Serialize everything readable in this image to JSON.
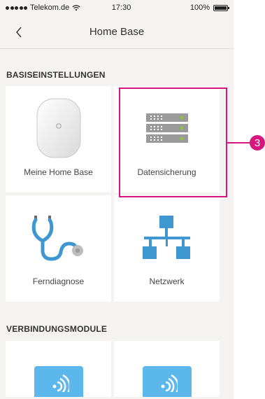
{
  "status_bar": {
    "carrier": "Telekom.de",
    "time": "17:30",
    "battery": "100%",
    "battery_level": 1.0
  },
  "nav": {
    "title": "Home Base",
    "back_icon": "chevron-left-icon"
  },
  "sections": [
    {
      "title": "BASISEINSTELLUNGEN",
      "tiles": [
        {
          "label": "Meine Home Base",
          "icon": "home-base-device-icon"
        },
        {
          "label": "Datensicherung",
          "icon": "server-icon"
        },
        {
          "label": "Ferndiagnose",
          "icon": "stethoscope-icon"
        },
        {
          "label": "Netzwerk",
          "icon": "network-icon"
        }
      ]
    },
    {
      "title": "VERBINDUNGSMODULE",
      "tiles": [
        {
          "label": "",
          "icon": "wireless-module-icon"
        },
        {
          "label": "",
          "icon": "wireless-module-icon"
        }
      ]
    }
  ],
  "callout": {
    "number": "3",
    "color": "#d6157e"
  },
  "colors": {
    "accent_blue": "#3e97d1",
    "module_blue": "#5bb7ec",
    "background": "#f4f3f1"
  }
}
